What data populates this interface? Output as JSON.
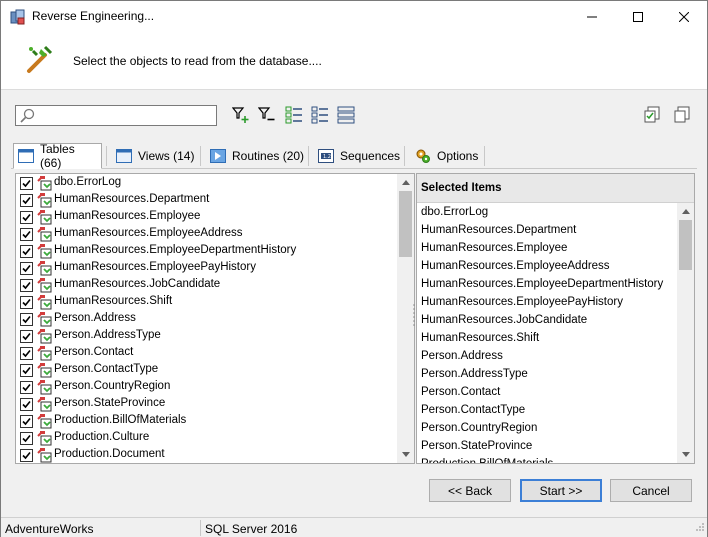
{
  "window": {
    "title": "Reverse Engineering...",
    "header_text": "Select the objects to read from the database...."
  },
  "search": {
    "value": "",
    "placeholder": ""
  },
  "tabs": [
    {
      "label": "Tables (66)",
      "icon": "table-icon",
      "active": true
    },
    {
      "label": "Views (14)",
      "icon": "view-icon",
      "active": false
    },
    {
      "label": "Routines (20)",
      "icon": "routine-icon",
      "active": false
    },
    {
      "label": "Sequences",
      "icon": "sequence-icon",
      "active": false
    },
    {
      "label": "Options",
      "icon": "options-icon",
      "active": false
    }
  ],
  "left_items": [
    {
      "label": "dbo.ErrorLog",
      "checked": true
    },
    {
      "label": "HumanResources.Department",
      "checked": true
    },
    {
      "label": "HumanResources.Employee",
      "checked": true
    },
    {
      "label": "HumanResources.EmployeeAddress",
      "checked": true
    },
    {
      "label": "HumanResources.EmployeeDepartmentHistory",
      "checked": true
    },
    {
      "label": "HumanResources.EmployeePayHistory",
      "checked": true
    },
    {
      "label": "HumanResources.JobCandidate",
      "checked": true
    },
    {
      "label": "HumanResources.Shift",
      "checked": true
    },
    {
      "label": "Person.Address",
      "checked": true
    },
    {
      "label": "Person.AddressType",
      "checked": true
    },
    {
      "label": "Person.Contact",
      "checked": true
    },
    {
      "label": "Person.ContactType",
      "checked": true
    },
    {
      "label": "Person.CountryRegion",
      "checked": true
    },
    {
      "label": "Person.StateProvince",
      "checked": true
    },
    {
      "label": "Production.BillOfMaterials",
      "checked": true
    },
    {
      "label": "Production.Culture",
      "checked": true
    },
    {
      "label": "Production.Document",
      "checked": true
    }
  ],
  "right_panel": {
    "header": "Selected Items",
    "items": [
      "dbo.ErrorLog",
      "HumanResources.Department",
      "HumanResources.Employee",
      "HumanResources.EmployeeAddress",
      "HumanResources.EmployeeDepartmentHistory",
      "HumanResources.EmployeePayHistory",
      "HumanResources.JobCandidate",
      "HumanResources.Shift",
      "Person.Address",
      "Person.AddressType",
      "Person.Contact",
      "Person.ContactType",
      "Person.CountryRegion",
      "Person.StateProvince",
      "Production.BillOfMaterials"
    ]
  },
  "buttons": {
    "back": "<< Back",
    "start": "Start >>",
    "cancel": "Cancel"
  },
  "status": {
    "database": "AdventureWorks",
    "server": "SQL Server 2016"
  },
  "colors": {
    "accent": "#3c7fd6",
    "checkmark": "#000000",
    "table_icon_red": "#d23c3c",
    "table_icon_green": "#3caa3c"
  }
}
